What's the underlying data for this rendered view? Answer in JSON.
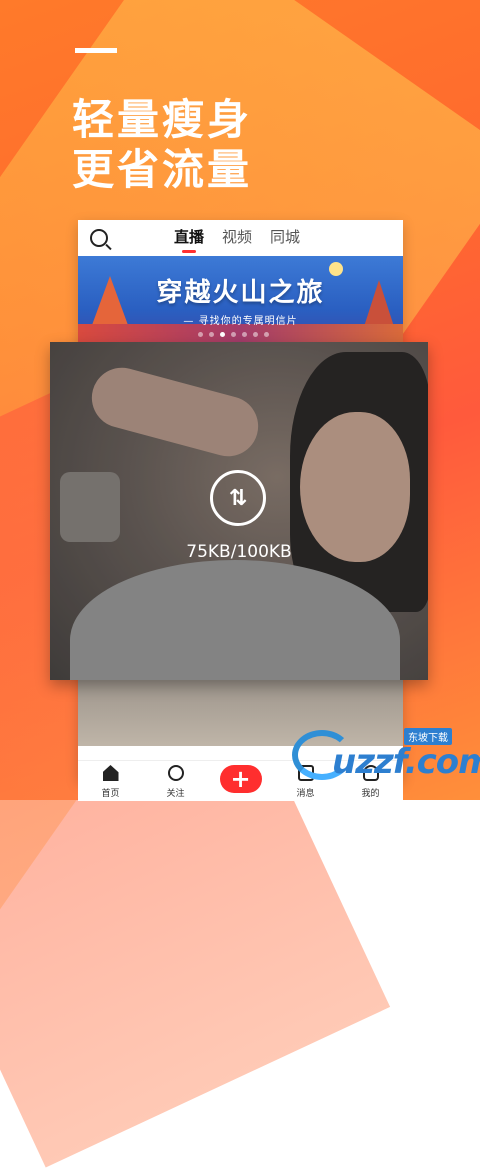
{
  "promo": {
    "headline_line1": "轻量瘦身",
    "headline_line2": "更省流量"
  },
  "app": {
    "tabs": [
      {
        "label": "直播",
        "active": true
      },
      {
        "label": "视频",
        "active": false
      },
      {
        "label": "同城",
        "active": false
      }
    ],
    "banner": {
      "title": "穿越火山之旅",
      "subtitle": "— 寻找你的专属明信片",
      "pages": 7,
      "current_page": 3
    },
    "video": {
      "speed_text": "75KB/100KB",
      "icon": "speed-arrows-icon"
    },
    "bottom_nav": [
      {
        "label": "首页",
        "icon": "home-icon"
      },
      {
        "label": "关注",
        "icon": "follow-icon"
      },
      {
        "label": "",
        "icon": "plus-icon"
      },
      {
        "label": "消息",
        "icon": "message-icon"
      },
      {
        "label": "我的",
        "icon": "profile-icon"
      }
    ]
  },
  "watermark": {
    "brand": "uzzf.com",
    "tag": "东坡下载"
  },
  "colors": {
    "accent": "#ff2e2e",
    "background": "#ff6a2e"
  }
}
